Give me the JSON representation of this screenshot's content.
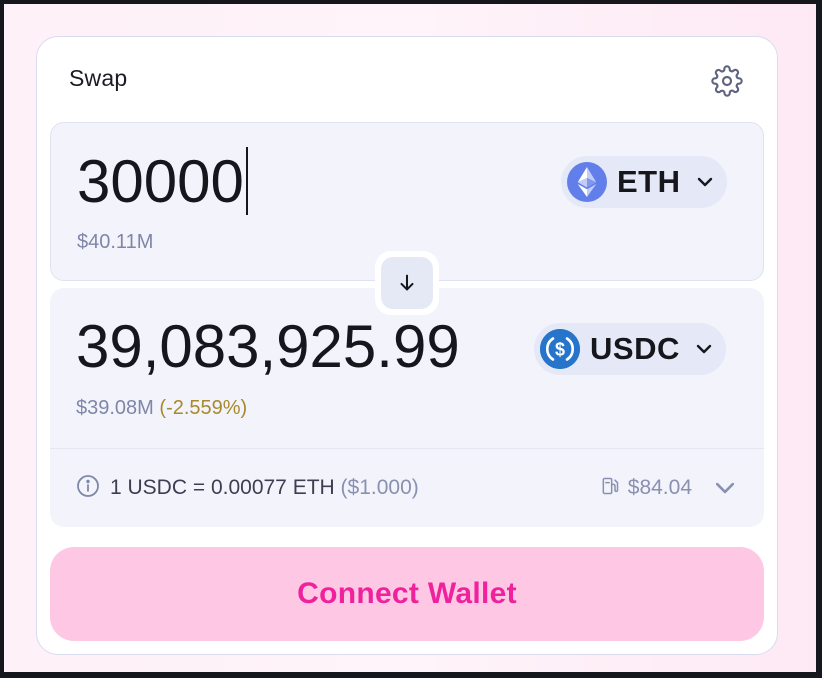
{
  "header": {
    "title": "Swap"
  },
  "sell": {
    "amount": "30000",
    "usd_value": "$40.11M",
    "token": {
      "symbol": "ETH",
      "icon": "ethereum-icon",
      "color": "#627eea"
    }
  },
  "buy": {
    "amount": "39,083,925.99",
    "usd_value": "$39.08M",
    "price_impact": "(-2.559%)",
    "token": {
      "symbol": "USDC",
      "icon": "usdc-icon",
      "color": "#2775ca"
    }
  },
  "details": {
    "rate": "1 USDC = 0.00077 ETH",
    "rate_usd": "($1.000)",
    "gas_fee": "$84.04",
    "info_icon": "info-icon",
    "gas_icon": "gas-pump-icon"
  },
  "action": {
    "connect_label": "Connect Wallet"
  },
  "colors": {
    "accent_pink": "#f0219d",
    "button_bg": "#fec8e5",
    "impact_warning": "#a8892b"
  }
}
